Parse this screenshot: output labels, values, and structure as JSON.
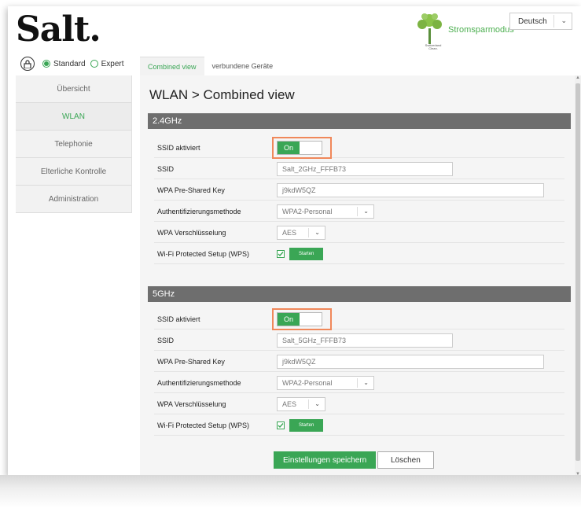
{
  "header": {
    "logo": "Salt.",
    "eco_label": "Stromsparmodus",
    "eco_sub": "Switzerland Clean.",
    "language": "Deutsch"
  },
  "mode": {
    "standard": "Standard",
    "expert": "Expert",
    "selected": "Standard"
  },
  "sidebar": {
    "items": [
      {
        "label": "Übersicht",
        "active": false
      },
      {
        "label": "WLAN",
        "active": true
      },
      {
        "label": "Telephonie",
        "active": false
      },
      {
        "label": "Elterliche Kontrolle",
        "active": false
      },
      {
        "label": "Administration",
        "active": false
      }
    ]
  },
  "tabs": [
    {
      "label": "Combined view",
      "active": true
    },
    {
      "label": "verbundene Geräte",
      "active": false
    }
  ],
  "page_title": "WLAN > Combined view",
  "band24": {
    "title": "2.4GHz",
    "ssid_enabled_label": "SSID aktiviert",
    "toggle": "On",
    "ssid_label": "SSID",
    "ssid_value": "Salt_2GHz_FFFB73",
    "psk_label": "WPA Pre-Shared Key",
    "psk_value": "j9kdW5QZ",
    "auth_label": "Authentifizierungsmethode",
    "auth_value": "WPA2-Personal",
    "enc_label": "WPA Verschlüsselung",
    "enc_value": "AES",
    "wps_label": "Wi-Fi Protected Setup (WPS)",
    "wps_button": "Starten"
  },
  "band5": {
    "title": "5GHz",
    "ssid_enabled_label": "SSID aktiviert",
    "toggle": "On",
    "ssid_label": "SSID",
    "ssid_value": "Salt_5GHz_FFFB73",
    "psk_label": "WPA Pre-Shared Key",
    "psk_value": "j9kdW5QZ",
    "auth_label": "Authentifizierungsmethode",
    "auth_value": "WPA2-Personal",
    "enc_label": "WPA Verschlüsselung",
    "enc_value": "AES",
    "wps_label": "Wi-Fi Protected Setup (WPS)",
    "wps_button": "Starten"
  },
  "actions": {
    "save": "Einstellungen speichern",
    "clear": "Löschen"
  },
  "colors": {
    "accent": "#3aa655",
    "highlight": "#f0885a",
    "section_bar": "#6e6e6e"
  }
}
